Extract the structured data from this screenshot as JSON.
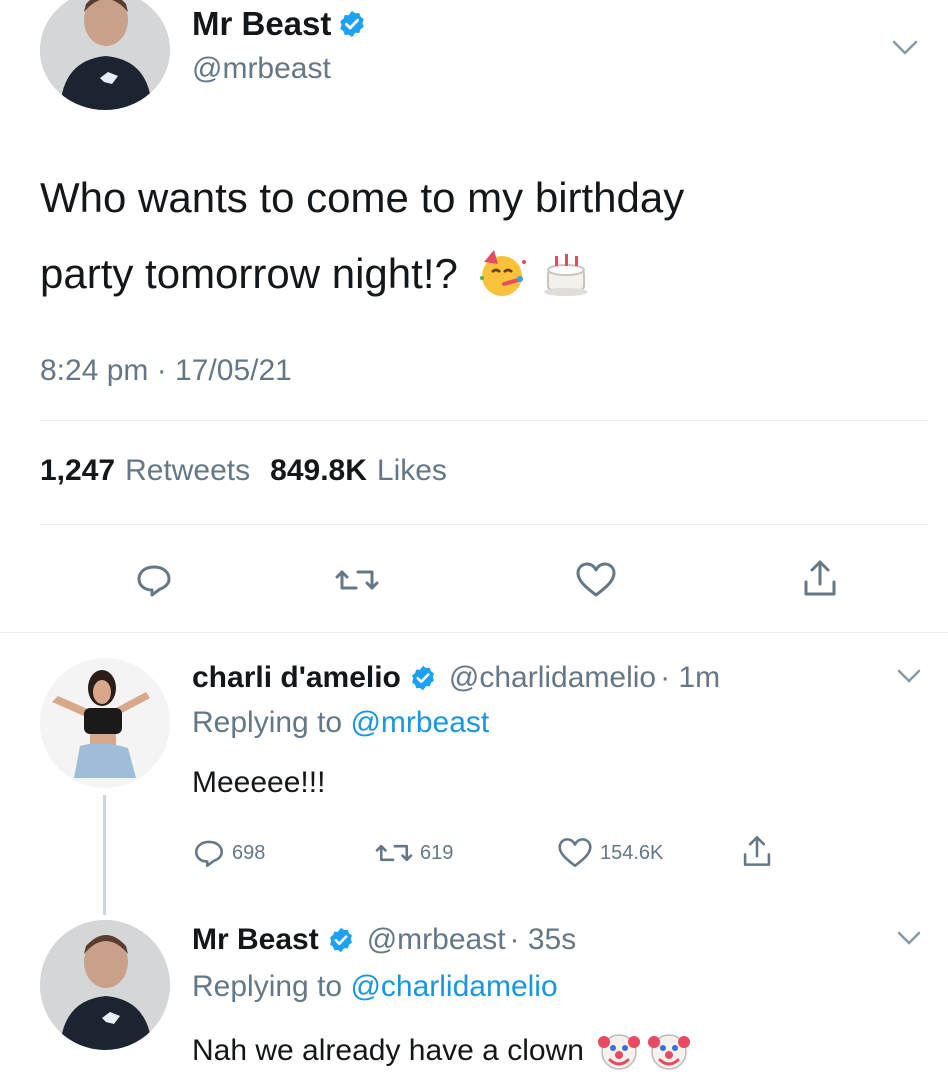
{
  "main_tweet": {
    "author_name": "Mr Beast",
    "author_handle": "@mrbeast",
    "text": "Who wants to come to my birthday party tomorrow night!?",
    "text_line1": "Who wants to come to my birthday",
    "text_line2": "party tomorrow night!?",
    "emojis": [
      "partying-face-icon",
      "birthday-cake-icon"
    ],
    "timestamp": "8:24 pm · 17/05/21",
    "retweets_count": "1,247",
    "retweets_label": "Retweets",
    "likes_count": "849.8K",
    "likes_label": "Likes"
  },
  "reply_1": {
    "author_name": "charli d'amelio",
    "author_handle": "@charlidamelio",
    "time": "· 1m",
    "replying_prefix": "Replying to",
    "replying_handle": "@mrbeast",
    "text": "Meeeee!!!",
    "reply_count": "698",
    "retweet_count": "619",
    "like_count": "154.6K"
  },
  "reply_2": {
    "author_name": "Mr Beast",
    "author_handle": "@mrbeast",
    "time": "· 35s",
    "replying_prefix": "Replying to",
    "replying_handle": "@charlidamelio",
    "text": "Nah we already have a clown",
    "emojis": [
      "clown-face-icon",
      "clown-face-icon"
    ]
  },
  "colors": {
    "verified_blue": "#1da1f2",
    "link_blue": "#1b95e0",
    "muted_gray": "#657786",
    "divider": "#e6ecf0"
  }
}
